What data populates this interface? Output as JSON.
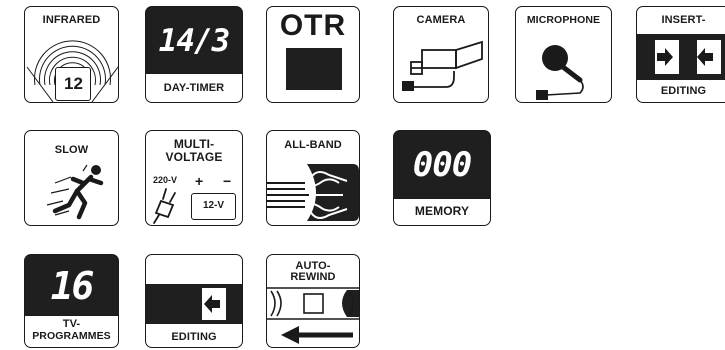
{
  "icons": {
    "infrared": {
      "label": "INFRARED",
      "number": "12"
    },
    "day_timer": {
      "display": "14/3",
      "label": "DAY-TIMER"
    },
    "otr": {
      "label": "OTR"
    },
    "camera": {
      "label": "CAMERA"
    },
    "microphone": {
      "label": "MICROPHONE"
    },
    "insert_editing": {
      "label_top": "INSERT-",
      "label_bottom": "EDITING"
    },
    "slow": {
      "label": "SLOW"
    },
    "multi_voltage": {
      "label_line1": "MULTI-",
      "label_line2": "VOLTAGE",
      "ac": "220-V",
      "dc": "12-V",
      "plus": "+",
      "minus": "−"
    },
    "all_band": {
      "label": "ALL-BAND"
    },
    "memory": {
      "display": "000",
      "label": "MEMORY"
    },
    "tv_programmes": {
      "display": "16",
      "label_line1": "TV-",
      "label_line2": "PROGRAMMES"
    },
    "editing": {
      "label": "EDITING"
    },
    "auto_rewind": {
      "label_line1": "AUTO-",
      "label_line2": "REWIND"
    }
  }
}
